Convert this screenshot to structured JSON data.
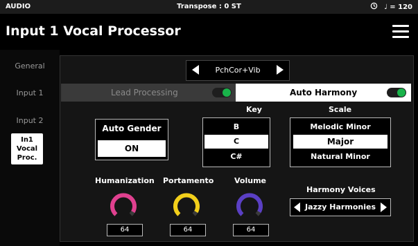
{
  "status_bar": {
    "left": "AUDIO",
    "center": "Transpose : 0 ST",
    "tempo_icon": "clock-icon",
    "tempo": "♩ = 120"
  },
  "header": {
    "title": "Input 1 Vocal Processor",
    "menu_icon": "hamburger-icon"
  },
  "sidebar": {
    "items": [
      {
        "label": "General"
      },
      {
        "label": "Input 1"
      },
      {
        "label": "Input 2"
      },
      {
        "label": "In1 Vocal",
        "label2": "Proc."
      }
    ],
    "active_index": 3
  },
  "mode_selector": {
    "value": "PchCor+Vib"
  },
  "tabs": {
    "lead": {
      "label": "Lead Processing",
      "toggle_on": true
    },
    "harmony": {
      "label": "Auto Harmony",
      "toggle_on": true
    }
  },
  "auto_gender": {
    "title": "Auto Gender",
    "value": "ON"
  },
  "key": {
    "header": "Key",
    "options": [
      "B",
      "C",
      "C#"
    ],
    "selected": "C"
  },
  "scale": {
    "header": "Scale",
    "options": [
      "Melodic Minor",
      "Major",
      "Natural Minor"
    ],
    "selected": "Major"
  },
  "knobs": [
    {
      "label": "Humanization",
      "value": "64",
      "color": "#e0408f"
    },
    {
      "label": "Portamento",
      "value": "64",
      "color": "#f2cf1a"
    },
    {
      "label": "Volume",
      "value": "64",
      "color": "#5a3fc4"
    }
  ],
  "harmony_voices": {
    "label": "Harmony Voices",
    "value": "Jazzy Harmonies"
  },
  "colors": {
    "toggle_on": "#19b34a",
    "knob_track": "#3a3a3a"
  }
}
